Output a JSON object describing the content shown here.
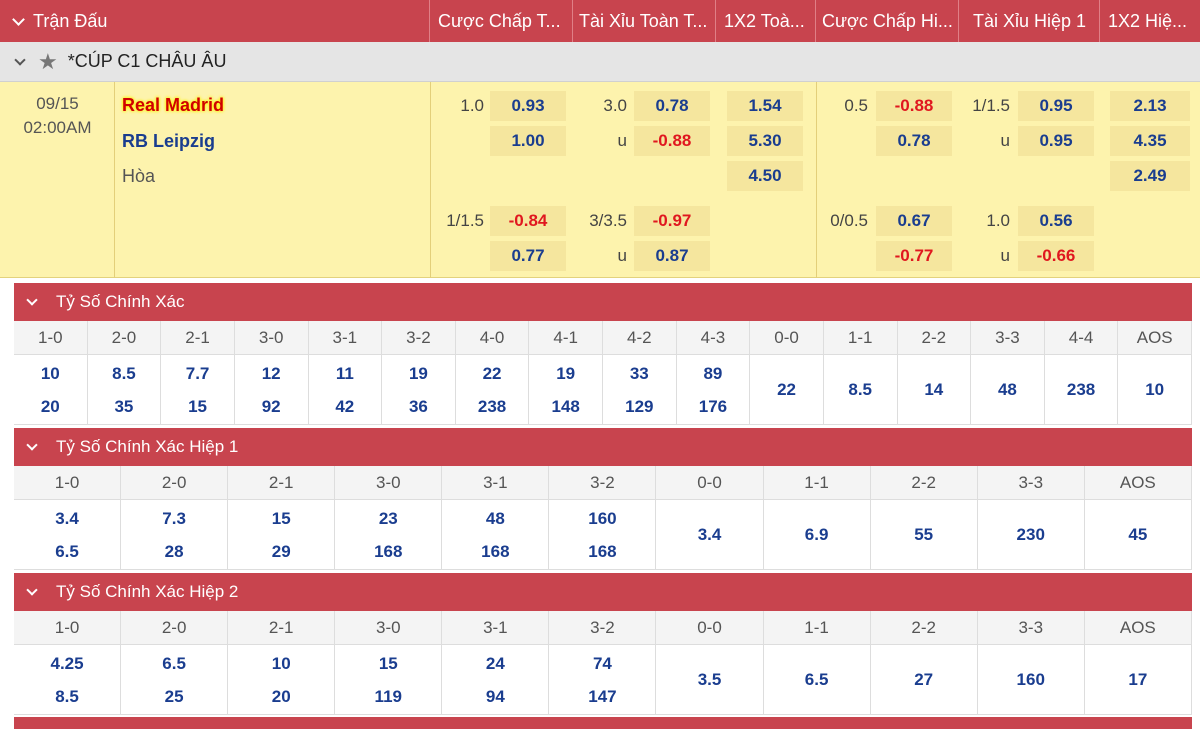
{
  "header": {
    "cols": [
      "Trận Đấu",
      "Cược Chấp T...",
      "Tài Xỉu Toàn T...",
      "1X2 Toà...",
      "Cược Chấp Hi...",
      "Tài Xỉu Hiệp 1",
      "1X2 Hiệ..."
    ]
  },
  "league": {
    "name": "*CÚP C1 CHÂU ÂU"
  },
  "match": {
    "date": "09/15",
    "time": "02:00AM",
    "home": "Real Madrid",
    "away": "RB Leipzig",
    "draw": "Hòa",
    "ft": {
      "hcap_line1": "1.0",
      "hcap_home1": "0.93",
      "hcap_away1": "1.00",
      "ou_line1": "3.0",
      "ou_over1": "0.78",
      "ou_u1": "u",
      "ou_under1": "-0.88",
      "x12_home": "1.54",
      "x12_away": "5.30",
      "x12_draw": "4.50",
      "hcap_line2": "1/1.5",
      "hcap_home2": "-0.84",
      "hcap_away2": "0.77",
      "ou_line2": "3/3.5",
      "ou_over2": "-0.97",
      "ou_u2": "u",
      "ou_under2": "0.87"
    },
    "h1": {
      "hcap_line1": "0.5",
      "hcap_home1": "-0.88",
      "hcap_away1": "0.78",
      "ou_line1": "1/1.5",
      "ou_over1": "0.95",
      "ou_u1": "u",
      "ou_under1": "0.95",
      "x12_home": "2.13",
      "x12_away": "4.35",
      "x12_draw": "2.49",
      "hcap_line2": "0/0.5",
      "hcap_home2": "0.67",
      "hcap_away2": "-0.77",
      "ou_line2": "1.0",
      "ou_over2": "0.56",
      "ou_u2": "u",
      "ou_under2": "-0.66"
    }
  },
  "sections": [
    {
      "title": "Tỷ Số Chính Xác"
    },
    {
      "title": "Tỷ Số Chính Xác Hiệp 1"
    },
    {
      "title": "Tỷ Số Chính Xác Hiệp 2"
    }
  ],
  "grid_full": {
    "heads": [
      "1-0",
      "2-0",
      "2-1",
      "3-0",
      "3-1",
      "3-2",
      "4-0",
      "4-1",
      "4-2",
      "4-3",
      "0-0",
      "1-1",
      "2-2",
      "3-3",
      "4-4",
      "AOS"
    ],
    "top": [
      "10",
      "8.5",
      "7.7",
      "12",
      "11",
      "19",
      "22",
      "19",
      "33",
      "89",
      "22",
      "8.5",
      "14",
      "48",
      "238",
      "10"
    ],
    "bottom": [
      "20",
      "35",
      "15",
      "92",
      "42",
      "36",
      "238",
      "148",
      "129",
      "176",
      "",
      "",
      "",
      "",
      "",
      ""
    ]
  },
  "grid_h1": {
    "heads": [
      "1-0",
      "2-0",
      "2-1",
      "3-0",
      "3-1",
      "3-2",
      "0-0",
      "1-1",
      "2-2",
      "3-3",
      "AOS"
    ],
    "top": [
      "3.4",
      "7.3",
      "15",
      "23",
      "48",
      "160",
      "3.4",
      "6.9",
      "55",
      "230",
      "45"
    ],
    "bottom": [
      "6.5",
      "28",
      "29",
      "168",
      "168",
      "168",
      "",
      "",
      "",
      "",
      ""
    ]
  },
  "grid_h2": {
    "heads": [
      "1-0",
      "2-0",
      "2-1",
      "3-0",
      "3-1",
      "3-2",
      "0-0",
      "1-1",
      "2-2",
      "3-3",
      "AOS"
    ],
    "top": [
      "4.25",
      "6.5",
      "10",
      "15",
      "24",
      "74",
      "3.5",
      "6.5",
      "27",
      "160",
      "17"
    ],
    "bottom": [
      "8.5",
      "25",
      "20",
      "119",
      "94",
      "147",
      "",
      "",
      "",
      "",
      ""
    ]
  }
}
